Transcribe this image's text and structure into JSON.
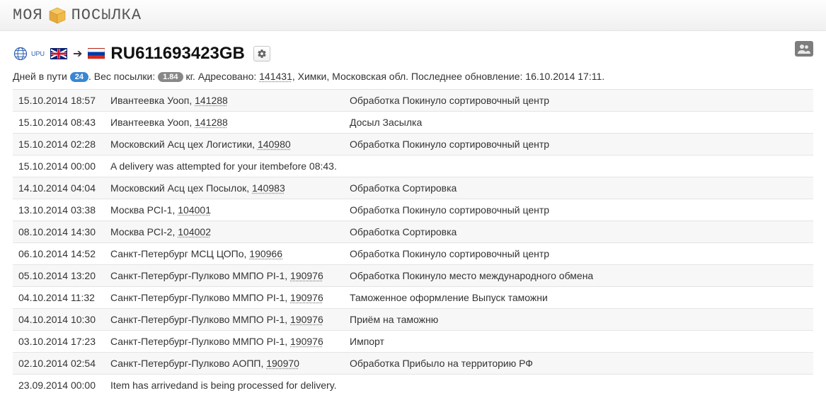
{
  "brand": {
    "part1": "Моя",
    "part2": "Посылка"
  },
  "header": {
    "upu_label": "UPU",
    "tracking_number": "RU611693423GB"
  },
  "summary": {
    "days_label": "Дней в пути",
    "days_value": "24",
    "weight_label": "Вес посылки:",
    "weight_value": "1.84",
    "weight_unit": "кг.",
    "addr_label": "Адресовано:",
    "addr_zip": "141431",
    "addr_rest": ", Химки, Московская обл.",
    "updated_label": "Последнее обновление:",
    "updated_value": "16.10.2014 17:11."
  },
  "rows": [
    {
      "date": "15.10.2014 18:57",
      "loc": "Ивантеевка Уооп, ",
      "zip": "141288",
      "status": "Обработка Покинуло сортировочный центр"
    },
    {
      "date": "15.10.2014 08:43",
      "loc": "Ивантеевка Уооп, ",
      "zip": "141288",
      "status": "Досыл Засылка"
    },
    {
      "date": "15.10.2014 02:28",
      "loc": "Московский Асц цех Логистики, ",
      "zip": "140980",
      "status": "Обработка Покинуло сортировочный центр"
    },
    {
      "date": "15.10.2014 00:00",
      "loc": "A delivery was attempted for your itembefore 08:43.",
      "zip": "",
      "status": ""
    },
    {
      "date": "14.10.2014 04:04",
      "loc": "Московский Асц цех Посылок, ",
      "zip": "140983",
      "status": "Обработка Сортировка"
    },
    {
      "date": "13.10.2014 03:38",
      "loc": "Москва PCI-1, ",
      "zip": "104001",
      "status": "Обработка Покинуло сортировочный центр"
    },
    {
      "date": "08.10.2014 14:30",
      "loc": "Москва PCI-2, ",
      "zip": "104002",
      "status": "Обработка Сортировка"
    },
    {
      "date": "06.10.2014 14:52",
      "loc": "Санкт-Петербург МСЦ ЦОПо, ",
      "zip": "190966",
      "status": "Обработка Покинуло сортировочный центр"
    },
    {
      "date": "05.10.2014 13:20",
      "loc": "Санкт-Петербург-Пулково ММПО PI-1, ",
      "zip": "190976",
      "status": "Обработка Покинуло место международного обмена"
    },
    {
      "date": "04.10.2014 11:32",
      "loc": "Санкт-Петербург-Пулково ММПО PI-1, ",
      "zip": "190976",
      "status": "Таможенное оформление Выпуск таможни"
    },
    {
      "date": "04.10.2014 10:30",
      "loc": "Санкт-Петербург-Пулково ММПО PI-1, ",
      "zip": "190976",
      "status": "Приём на таможню"
    },
    {
      "date": "03.10.2014 17:23",
      "loc": "Санкт-Петербург-Пулково ММПО PI-1, ",
      "zip": "190976",
      "status": "Импорт"
    },
    {
      "date": "02.10.2014 02:54",
      "loc": "Санкт-Петербург-Пулково АОПП, ",
      "zip": "190970",
      "status": "Обработка Прибыло на территорию РФ"
    },
    {
      "date": "23.09.2014 00:00",
      "loc": "Item has arrivedand is being processed for delivery.",
      "zip": "",
      "status": ""
    }
  ]
}
